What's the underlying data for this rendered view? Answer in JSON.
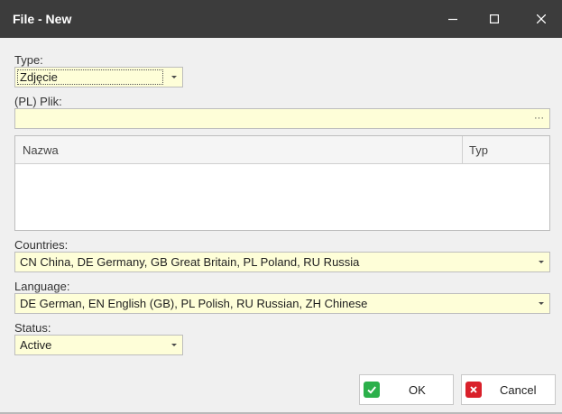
{
  "window": {
    "title": "File - New",
    "minimize_icon": "minimize-icon",
    "maximize_icon": "maximize-icon",
    "close_icon": "close-icon"
  },
  "form": {
    "type_label": "Type:",
    "type_value": "Zdjęcie",
    "file_label": "(PL) Plik:",
    "file_value": "",
    "file_browse_label": "···",
    "grid": {
      "columns": [
        "Nazwa",
        "Typ"
      ],
      "rows": []
    },
    "countries_label": "Countries:",
    "countries_value": "CN China, DE Germany, GB Great Britain, PL Poland, RU Russia",
    "language_label": "Language:",
    "language_value": "DE German, EN English (GB), PL Polish, RU Russian, ZH Chinese",
    "status_label": "Status:",
    "status_value": "Active"
  },
  "buttons": {
    "ok_label": "OK",
    "cancel_label": "Cancel",
    "ok_icon": "check-icon",
    "cancel_icon": "x-icon"
  },
  "colors": {
    "titlebar": "#3c3c3c",
    "field_background": "#fefed8",
    "ok_green": "#2bb04a",
    "cancel_red": "#d9202a"
  }
}
